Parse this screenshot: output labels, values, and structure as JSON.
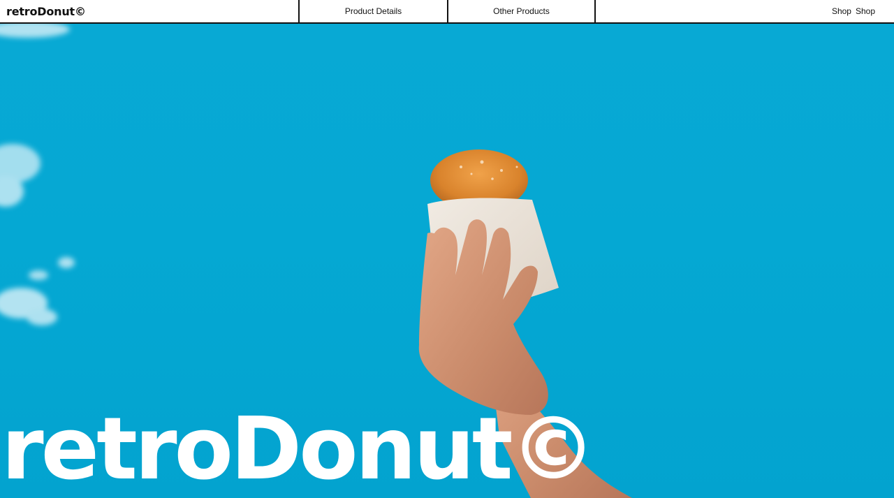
{
  "nav": {
    "logo": "retroDonut©",
    "links": [
      {
        "label": "Product Details"
      },
      {
        "label": "Other Products"
      }
    ],
    "shop_links": [
      "Shop",
      "Shop"
    ]
  },
  "hero": {
    "title": "retroDonut©",
    "sky_color": "#05a8d3",
    "title_color": "#ffffff"
  }
}
